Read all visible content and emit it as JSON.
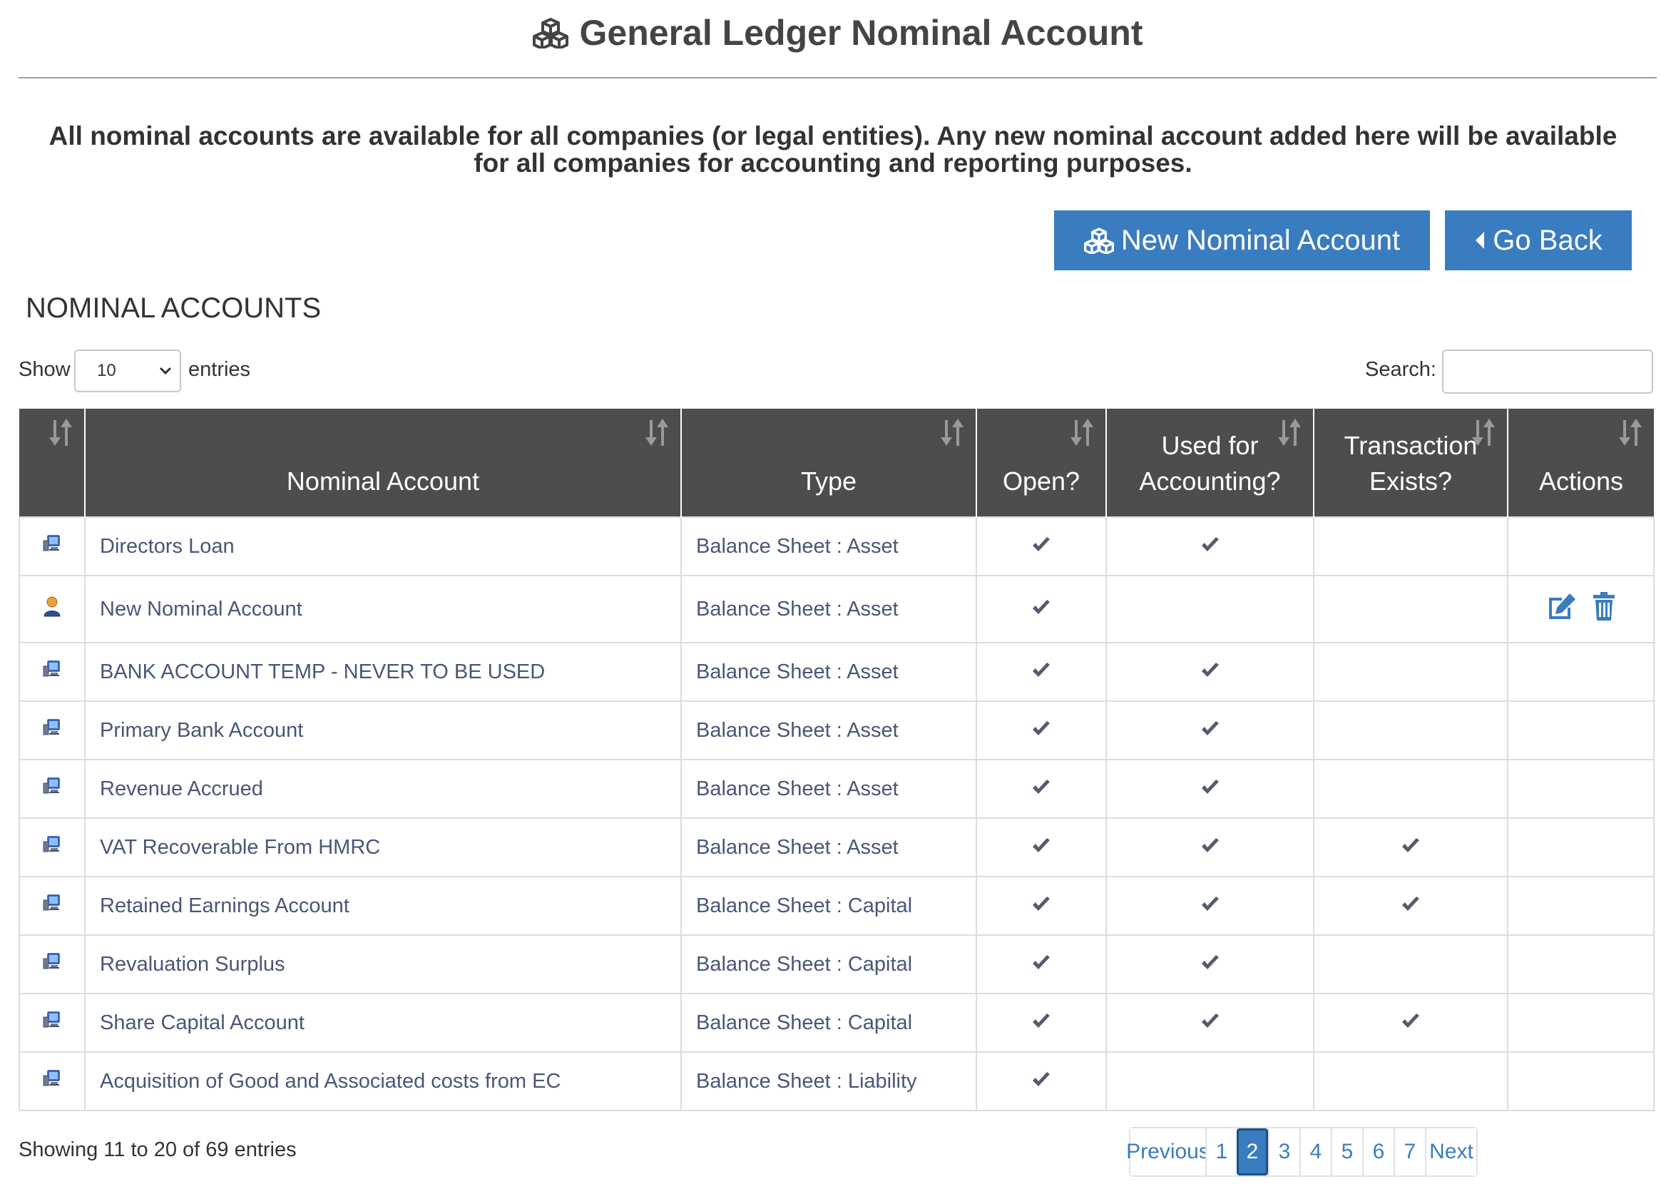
{
  "header": {
    "title": "General Ledger Nominal Account"
  },
  "intro_text": "All nominal accounts are available for all companies (or legal entities). Any new nominal account added here will be available for all companies for accounting and reporting purposes.",
  "actions": {
    "new_label": "New Nominal Account",
    "back_label": "Go Back"
  },
  "section_heading": "NOMINAL ACCOUNTS",
  "length": {
    "show_label": "Show",
    "value": "10",
    "entries_label": "entries"
  },
  "search": {
    "label": "Search:",
    "value": ""
  },
  "colors": {
    "accent": "#3a7cc0",
    "header_bg": "#4d4d4d",
    "check": "#555b6e"
  },
  "table": {
    "columns": [
      "",
      "Nominal Account",
      "Type",
      "Open?",
      "Used for Accounting?",
      "Transaction Exists?",
      "Actions"
    ],
    "rows": [
      {
        "icon": "computer-icon",
        "name": "Directors Loan",
        "type": "Balance Sheet : Asset",
        "open": true,
        "used": true,
        "txn": false,
        "editable": false
      },
      {
        "icon": "user-icon",
        "name": "New Nominal Account",
        "type": "Balance Sheet : Asset",
        "open": true,
        "used": false,
        "txn": false,
        "editable": true
      },
      {
        "icon": "computer-icon",
        "name": "BANK ACCOUNT TEMP - NEVER TO BE USED",
        "type": "Balance Sheet : Asset",
        "open": true,
        "used": true,
        "txn": false,
        "editable": false
      },
      {
        "icon": "computer-icon",
        "name": "Primary Bank Account",
        "type": "Balance Sheet : Asset",
        "open": true,
        "used": true,
        "txn": false,
        "editable": false
      },
      {
        "icon": "computer-icon",
        "name": "Revenue Accrued",
        "type": "Balance Sheet : Asset",
        "open": true,
        "used": true,
        "txn": false,
        "editable": false
      },
      {
        "icon": "computer-icon",
        "name": "VAT Recoverable From HMRC",
        "type": "Balance Sheet : Asset",
        "open": true,
        "used": true,
        "txn": true,
        "editable": false
      },
      {
        "icon": "computer-icon",
        "name": "Retained Earnings Account",
        "type": "Balance Sheet : Capital",
        "open": true,
        "used": true,
        "txn": true,
        "editable": false
      },
      {
        "icon": "computer-icon",
        "name": "Revaluation Surplus",
        "type": "Balance Sheet : Capital",
        "open": true,
        "used": true,
        "txn": false,
        "editable": false
      },
      {
        "icon": "computer-icon",
        "name": "Share Capital Account",
        "type": "Balance Sheet : Capital",
        "open": true,
        "used": true,
        "txn": true,
        "editable": false
      },
      {
        "icon": "computer-icon",
        "name": "Acquisition of Good and Associated costs from EC",
        "type": "Balance Sheet : Liability",
        "open": true,
        "used": false,
        "txn": false,
        "editable": false
      }
    ]
  },
  "footer": {
    "info": "Showing 11 to 20 of 69 entries",
    "pagination": {
      "previous": "Previous",
      "next": "Next",
      "pages": [
        "1",
        "2",
        "3",
        "4",
        "5",
        "6",
        "7"
      ],
      "active": "2"
    }
  }
}
